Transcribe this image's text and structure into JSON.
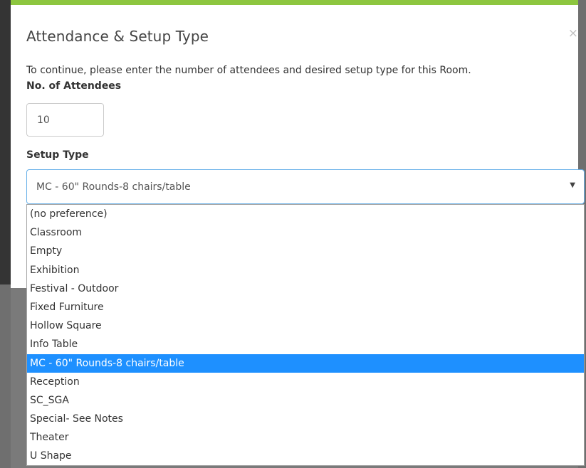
{
  "modal": {
    "title": "Attendance & Setup Type",
    "close_label": "×",
    "instructions": "To continue, please enter the number of attendees and desired setup type for this Room.",
    "attendees_label": "No. of Attendees",
    "attendees_value": "10",
    "setup_label": "Setup Type",
    "setup_selected": "MC - 60\" Rounds-8 chairs/table",
    "caret": "▼"
  },
  "setup_options": [
    {
      "label": "(no preference)",
      "selected": false
    },
    {
      "label": "Classroom",
      "selected": false
    },
    {
      "label": "Empty",
      "selected": false
    },
    {
      "label": "Exhibition",
      "selected": false
    },
    {
      "label": "Festival - Outdoor",
      "selected": false
    },
    {
      "label": "Fixed Furniture",
      "selected": false
    },
    {
      "label": "Hollow Square",
      "selected": false
    },
    {
      "label": "Info Table",
      "selected": false
    },
    {
      "label": "MC - 60\" Rounds-8 chairs/table",
      "selected": true
    },
    {
      "label": "Reception",
      "selected": false
    },
    {
      "label": "SC_SGA",
      "selected": false
    },
    {
      "label": "Special- See Notes",
      "selected": false
    },
    {
      "label": "Theater",
      "selected": false
    },
    {
      "label": "U Shape",
      "selected": false
    }
  ],
  "colors": {
    "accent_bar": "#8dc63f",
    "selected_option": "#1e90ff",
    "focus_border": "#66afe9"
  }
}
